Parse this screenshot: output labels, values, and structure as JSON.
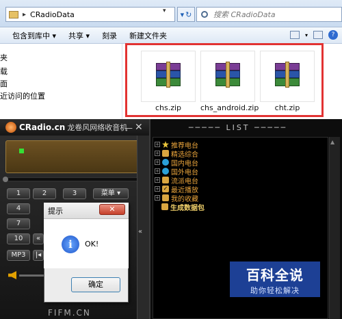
{
  "explorer": {
    "path": "CRadioData",
    "search_placeholder": "搜索 CRadioData",
    "toolbar": [
      "包含到库中 ▾",
      "共享 ▾",
      "刻录",
      "新建文件夹"
    ],
    "sidebar": [
      "夹",
      "载",
      "面",
      "近访问的位置"
    ],
    "files": [
      {
        "name": "chs.zip"
      },
      {
        "name": "chs_android.zip"
      },
      {
        "name": "cht.zip"
      }
    ]
  },
  "cradio": {
    "name": "CRadio.cn",
    "subtitle": "龙卷风网络收音机",
    "list_header": "LIST",
    "keys": [
      "1",
      "2",
      "3",
      "菜单 ▾",
      "4",
      "7",
      "10",
      "MP3"
    ],
    "tree": [
      {
        "label": "推荐电台",
        "color": "#e8c43b"
      },
      {
        "label": "精选综合",
        "color": "#d9a640"
      },
      {
        "label": "国内电台",
        "color": "#2aa0d8"
      },
      {
        "label": "国外电台",
        "color": "#2aa0d8"
      },
      {
        "label": "流派电台",
        "color": "#d9a640"
      },
      {
        "label": "最近播放",
        "color": "#d9a640"
      },
      {
        "label": "我的收藏",
        "color": "#d9a640"
      },
      {
        "label": "生成数据包",
        "color": "#d9a640"
      }
    ],
    "bottom": "FIFM.CN"
  },
  "dialog": {
    "title": "提示",
    "message": "OK!",
    "ok_label": "确定",
    "close_label": "✕",
    "icon_letter": "i"
  },
  "watermark": {
    "brand": "百科全说",
    "tagline": "助你轻松解决"
  }
}
